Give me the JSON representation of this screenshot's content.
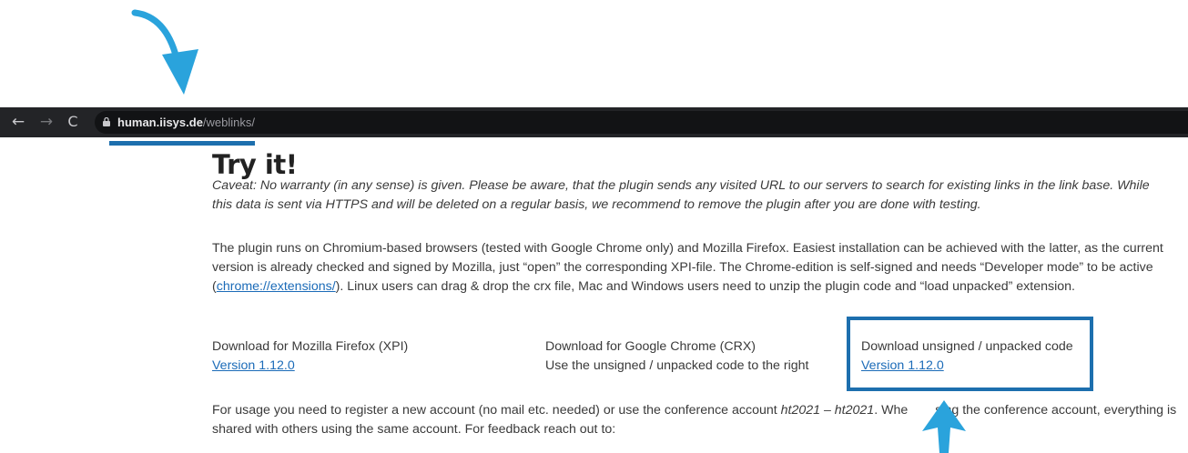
{
  "browser": {
    "back_glyph": "←",
    "forward_glyph": "→",
    "reload_glyph": "C",
    "url_domain": "human.iisys.de",
    "url_path": "/weblinks/"
  },
  "page": {
    "title": "Try it!",
    "caveat": "Caveat: No warranty (in any sense) is given. Please be aware, that the plugin sends any visited URL to our servers to search for existing links in the link base. While this data is sent via HTTPS and will be deleted on a regular basis, we recommend to remove the plugin after you are done with testing.",
    "intro_before": "The plugin runs on Chromium-based browsers (tested with Google Chrome only) and Mozilla Firefox. Easiest installation can be achieved with the latter, as the current version is already checked and signed by Mozilla, just “open” the corresponding XPI-file. The Chrome-edition is self-signed and needs “Developer mode” to be active (",
    "intro_link": "chrome://extensions/",
    "intro_after": "). Linux users can drag & drop the crx file, Mac and Windows users need to unzip the plugin code and “load unpacked” extension.",
    "downloads": [
      {
        "label": "Download for Mozilla Firefox (XPI)",
        "link": "Version 1.12.0"
      },
      {
        "label": "Download for Google Chrome (CRX)",
        "note": "Use the unsigned / unpacked code to the right"
      },
      {
        "label": "Download unsigned / unpacked code",
        "link": "Version 1.12.0"
      }
    ],
    "usage_before": "For usage you need to register a new account (no mail etc. needed) or use the conference account ",
    "usage_account": "ht2021 – ht2021",
    "usage_mid": ". Whe",
    "usage_after": "sing the conference account, everything is shared with others using the same account. For feedback reach out to:"
  },
  "colors": {
    "annotation_arrow": "#2aa3dc",
    "annotation_box": "#1d6fae",
    "link": "#1b6bb8"
  }
}
